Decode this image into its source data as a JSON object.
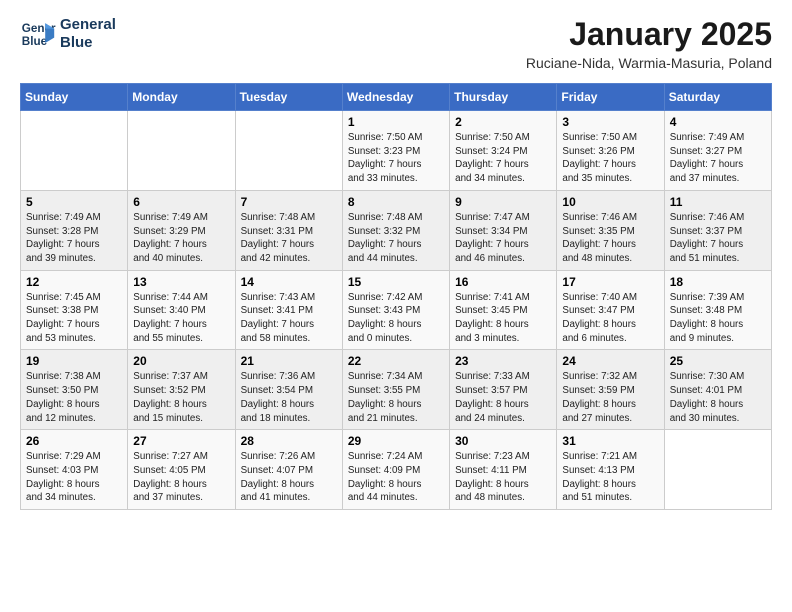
{
  "header": {
    "logo_line1": "General",
    "logo_line2": "Blue",
    "title": "January 2025",
    "subtitle": "Ruciane-Nida, Warmia-Masuria, Poland"
  },
  "weekdays": [
    "Sunday",
    "Monday",
    "Tuesday",
    "Wednesday",
    "Thursday",
    "Friday",
    "Saturday"
  ],
  "weeks": [
    [
      {
        "day": "",
        "info": ""
      },
      {
        "day": "",
        "info": ""
      },
      {
        "day": "",
        "info": ""
      },
      {
        "day": "1",
        "info": "Sunrise: 7:50 AM\nSunset: 3:23 PM\nDaylight: 7 hours\nand 33 minutes."
      },
      {
        "day": "2",
        "info": "Sunrise: 7:50 AM\nSunset: 3:24 PM\nDaylight: 7 hours\nand 34 minutes."
      },
      {
        "day": "3",
        "info": "Sunrise: 7:50 AM\nSunset: 3:26 PM\nDaylight: 7 hours\nand 35 minutes."
      },
      {
        "day": "4",
        "info": "Sunrise: 7:49 AM\nSunset: 3:27 PM\nDaylight: 7 hours\nand 37 minutes."
      }
    ],
    [
      {
        "day": "5",
        "info": "Sunrise: 7:49 AM\nSunset: 3:28 PM\nDaylight: 7 hours\nand 39 minutes."
      },
      {
        "day": "6",
        "info": "Sunrise: 7:49 AM\nSunset: 3:29 PM\nDaylight: 7 hours\nand 40 minutes."
      },
      {
        "day": "7",
        "info": "Sunrise: 7:48 AM\nSunset: 3:31 PM\nDaylight: 7 hours\nand 42 minutes."
      },
      {
        "day": "8",
        "info": "Sunrise: 7:48 AM\nSunset: 3:32 PM\nDaylight: 7 hours\nand 44 minutes."
      },
      {
        "day": "9",
        "info": "Sunrise: 7:47 AM\nSunset: 3:34 PM\nDaylight: 7 hours\nand 46 minutes."
      },
      {
        "day": "10",
        "info": "Sunrise: 7:46 AM\nSunset: 3:35 PM\nDaylight: 7 hours\nand 48 minutes."
      },
      {
        "day": "11",
        "info": "Sunrise: 7:46 AM\nSunset: 3:37 PM\nDaylight: 7 hours\nand 51 minutes."
      }
    ],
    [
      {
        "day": "12",
        "info": "Sunrise: 7:45 AM\nSunset: 3:38 PM\nDaylight: 7 hours\nand 53 minutes."
      },
      {
        "day": "13",
        "info": "Sunrise: 7:44 AM\nSunset: 3:40 PM\nDaylight: 7 hours\nand 55 minutes."
      },
      {
        "day": "14",
        "info": "Sunrise: 7:43 AM\nSunset: 3:41 PM\nDaylight: 7 hours\nand 58 minutes."
      },
      {
        "day": "15",
        "info": "Sunrise: 7:42 AM\nSunset: 3:43 PM\nDaylight: 8 hours\nand 0 minutes."
      },
      {
        "day": "16",
        "info": "Sunrise: 7:41 AM\nSunset: 3:45 PM\nDaylight: 8 hours\nand 3 minutes."
      },
      {
        "day": "17",
        "info": "Sunrise: 7:40 AM\nSunset: 3:47 PM\nDaylight: 8 hours\nand 6 minutes."
      },
      {
        "day": "18",
        "info": "Sunrise: 7:39 AM\nSunset: 3:48 PM\nDaylight: 8 hours\nand 9 minutes."
      }
    ],
    [
      {
        "day": "19",
        "info": "Sunrise: 7:38 AM\nSunset: 3:50 PM\nDaylight: 8 hours\nand 12 minutes."
      },
      {
        "day": "20",
        "info": "Sunrise: 7:37 AM\nSunset: 3:52 PM\nDaylight: 8 hours\nand 15 minutes."
      },
      {
        "day": "21",
        "info": "Sunrise: 7:36 AM\nSunset: 3:54 PM\nDaylight: 8 hours\nand 18 minutes."
      },
      {
        "day": "22",
        "info": "Sunrise: 7:34 AM\nSunset: 3:55 PM\nDaylight: 8 hours\nand 21 minutes."
      },
      {
        "day": "23",
        "info": "Sunrise: 7:33 AM\nSunset: 3:57 PM\nDaylight: 8 hours\nand 24 minutes."
      },
      {
        "day": "24",
        "info": "Sunrise: 7:32 AM\nSunset: 3:59 PM\nDaylight: 8 hours\nand 27 minutes."
      },
      {
        "day": "25",
        "info": "Sunrise: 7:30 AM\nSunset: 4:01 PM\nDaylight: 8 hours\nand 30 minutes."
      }
    ],
    [
      {
        "day": "26",
        "info": "Sunrise: 7:29 AM\nSunset: 4:03 PM\nDaylight: 8 hours\nand 34 minutes."
      },
      {
        "day": "27",
        "info": "Sunrise: 7:27 AM\nSunset: 4:05 PM\nDaylight: 8 hours\nand 37 minutes."
      },
      {
        "day": "28",
        "info": "Sunrise: 7:26 AM\nSunset: 4:07 PM\nDaylight: 8 hours\nand 41 minutes."
      },
      {
        "day": "29",
        "info": "Sunrise: 7:24 AM\nSunset: 4:09 PM\nDaylight: 8 hours\nand 44 minutes."
      },
      {
        "day": "30",
        "info": "Sunrise: 7:23 AM\nSunset: 4:11 PM\nDaylight: 8 hours\nand 48 minutes."
      },
      {
        "day": "31",
        "info": "Sunrise: 7:21 AM\nSunset: 4:13 PM\nDaylight: 8 hours\nand 51 minutes."
      },
      {
        "day": "",
        "info": ""
      }
    ]
  ]
}
